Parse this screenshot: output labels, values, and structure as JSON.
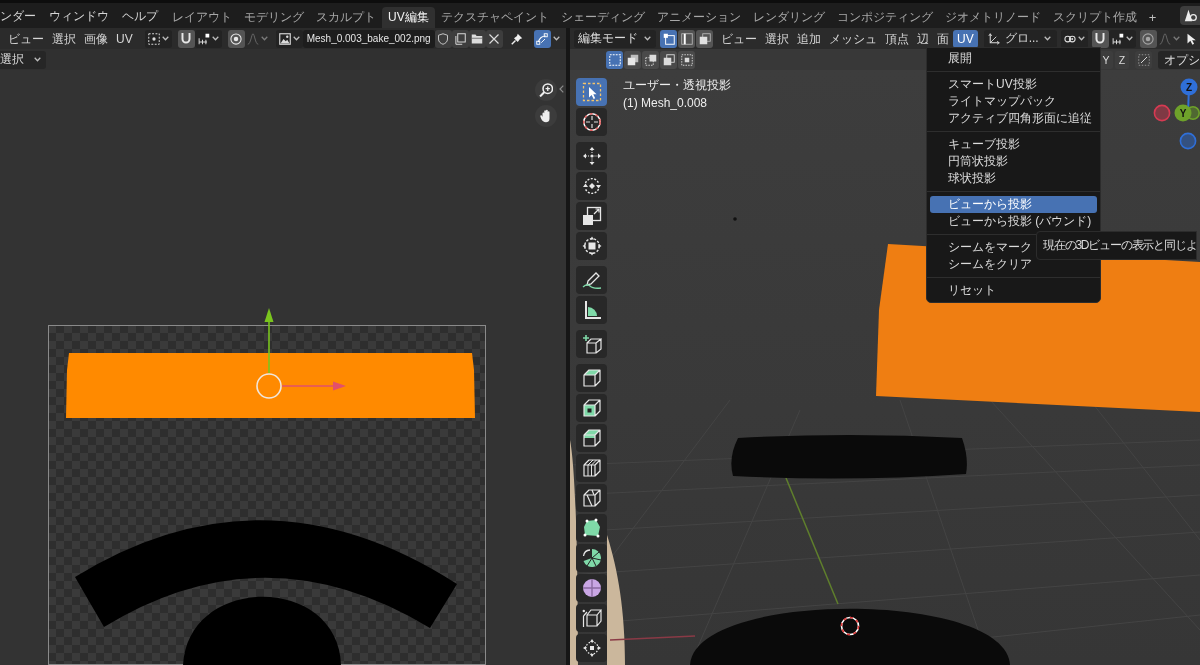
{
  "top_bar": {
    "menus": [
      "ンダー",
      "ウィンドウ",
      "ヘルプ"
    ],
    "workspaces": [
      {
        "label": "レイアウト",
        "selected": false
      },
      {
        "label": "モデリング",
        "selected": false
      },
      {
        "label": "スカルプト",
        "selected": false
      },
      {
        "label": "UV編集",
        "selected": true
      },
      {
        "label": "テクスチャペイント",
        "selected": false
      },
      {
        "label": "シェーディング",
        "selected": false
      },
      {
        "label": "アニメーション",
        "selected": false
      },
      {
        "label": "レンダリング",
        "selected": false
      },
      {
        "label": "コンポジティング",
        "selected": false
      },
      {
        "label": "ジオメトリノード",
        "selected": false
      },
      {
        "label": "スクリプト作成",
        "selected": false
      }
    ],
    "add_workspace": "+"
  },
  "uv_editor": {
    "menus": [
      "ビュー",
      "選択",
      "画像",
      "UV"
    ],
    "image_name": "Mesh_0.003_bake_002.png",
    "sync_selection": {
      "on": true
    },
    "select_dropdown": "選択"
  },
  "viewport": {
    "mode": "編集モード",
    "select_modes": [
      {
        "kind": "vertex",
        "selected": true
      },
      {
        "kind": "edge",
        "selected": false
      },
      {
        "kind": "face",
        "selected": false
      }
    ],
    "menus": [
      {
        "label": "ビュー",
        "selected": false
      },
      {
        "label": "選択",
        "selected": false
      },
      {
        "label": "追加",
        "selected": false
      },
      {
        "label": "メッシュ",
        "selected": false
      },
      {
        "label": "頂点",
        "selected": false
      },
      {
        "label": "辺",
        "selected": false
      },
      {
        "label": "面",
        "selected": false
      },
      {
        "label": "UV",
        "selected": true
      }
    ],
    "orientation": "グロ...",
    "tool_modes": [
      {
        "kind": "new",
        "selected": true
      },
      {
        "kind": "extend",
        "selected": false
      },
      {
        "kind": "subtract",
        "selected": false
      },
      {
        "kind": "invert",
        "selected": false
      },
      {
        "kind": "intersect",
        "selected": false
      }
    ],
    "axis_toggles": [
      "Y",
      "Z"
    ],
    "options": "オプシ",
    "view_name": "ユーザー・透視投影",
    "object_name": "(1) Mesh_0.008",
    "tool_groups": [
      [
        {
          "kind": "select_box",
          "selected": true
        },
        {
          "kind": "cursor",
          "selected": false
        }
      ],
      [
        {
          "kind": "move",
          "selected": false
        },
        {
          "kind": "rotate",
          "selected": false
        },
        {
          "kind": "scale",
          "selected": false
        },
        {
          "kind": "transform",
          "selected": false
        }
      ],
      [
        {
          "kind": "annotate",
          "selected": false
        },
        {
          "kind": "measure",
          "selected": false
        }
      ],
      [
        {
          "kind": "add_cube",
          "selected": false
        }
      ],
      [
        {
          "kind": "extrude",
          "selected": false
        },
        {
          "kind": "inset",
          "selected": false
        },
        {
          "kind": "bevel",
          "selected": false
        },
        {
          "kind": "loop_cut",
          "selected": false
        },
        {
          "kind": "knife",
          "selected": false
        },
        {
          "kind": "poly_build",
          "selected": false
        },
        {
          "kind": "spin",
          "selected": false
        },
        {
          "kind": "smooth",
          "selected": false
        },
        {
          "kind": "edge_slide",
          "selected": false
        },
        {
          "kind": "shrink_fatten",
          "selected": false
        }
      ]
    ],
    "navigation_gizmo": [
      {
        "kind": "positive",
        "label": "Z",
        "color": "#2f6fd8"
      },
      {
        "kind": "negative",
        "color": "#d63a52"
      },
      {
        "kind": "negative",
        "color": "#6ea22a"
      },
      {
        "kind": "positive",
        "label": "Y",
        "color": "#6ea22a"
      },
      {
        "kind": "negative",
        "color": "#2f6fd8"
      }
    ]
  },
  "uv_menu": {
    "sections": [
      [
        {
          "label": "展開",
          "selected": false
        }
      ],
      [
        {
          "label": "スマートUV投影",
          "selected": false
        },
        {
          "label": "ライトマップパック",
          "selected": false
        },
        {
          "label": "アクティブ四角形面に追従",
          "selected": false
        }
      ],
      [
        {
          "label": "キューブ投影",
          "selected": false
        },
        {
          "label": "円筒状投影",
          "selected": false
        },
        {
          "label": "球状投影",
          "selected": false
        }
      ],
      [
        {
          "label": "ビューから投影",
          "selected": true
        },
        {
          "label": "ビューから投影 (バウンド)",
          "selected": false
        }
      ],
      [
        {
          "label": "シームをマーク",
          "selected": false
        },
        {
          "label": "シームをクリア",
          "selected": false
        }
      ],
      [
        {
          "label": "リセット",
          "selected": false
        }
      ]
    ]
  },
  "tooltip": {
    "text": "現在の3Dビューの表示と同じよ"
  }
}
